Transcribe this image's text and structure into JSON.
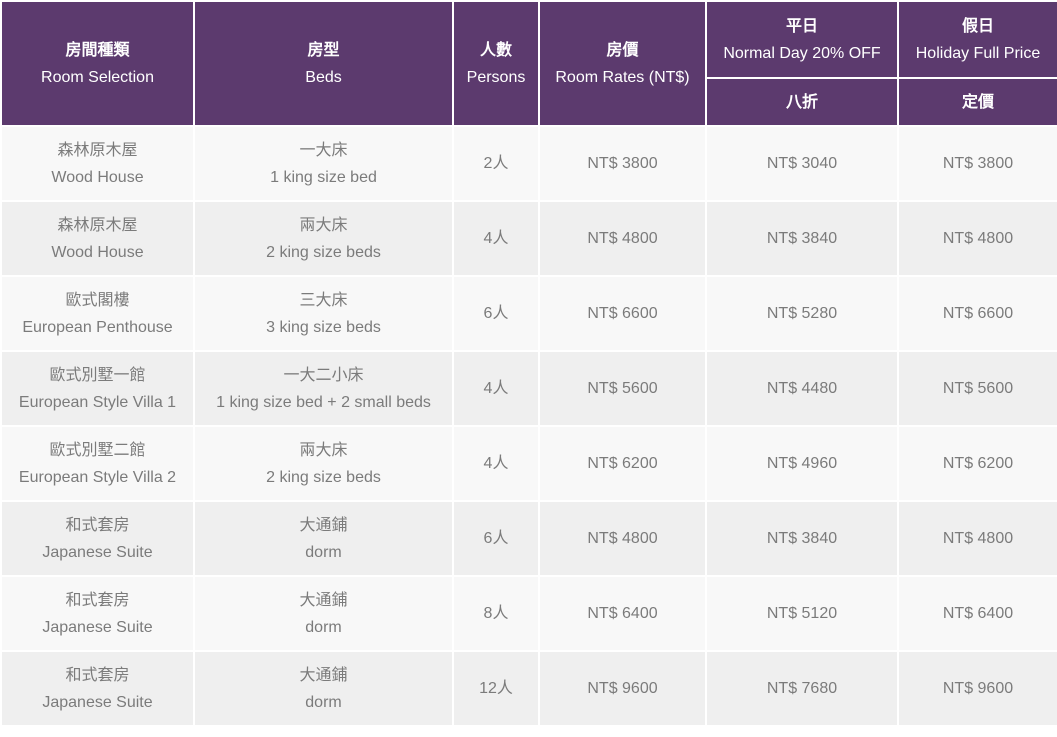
{
  "header": {
    "room": {
      "zh": "房間種類",
      "en": "Room Selection"
    },
    "beds": {
      "zh": "房型",
      "en": "Beds"
    },
    "persons": {
      "zh": "人數",
      "en": "Persons"
    },
    "rates": {
      "zh": "房價",
      "en": "Room Rates (NT$)"
    },
    "normal": {
      "zh": "平日",
      "en": "Normal Day 20% OFF",
      "sub": "八折"
    },
    "holiday": {
      "zh": "假日",
      "en": "Holiday Full Price",
      "sub": "定價"
    }
  },
  "rows": [
    {
      "room_zh": "森林原木屋",
      "room_en": "Wood House",
      "bed_zh": "一大床",
      "bed_en": "1 king size bed",
      "persons": "2人",
      "rate": "NT$ 3800",
      "normal": "NT$ 3040",
      "holiday": "NT$ 3800"
    },
    {
      "room_zh": "森林原木屋",
      "room_en": "Wood House",
      "bed_zh": "兩大床",
      "bed_en": "2 king size beds",
      "persons": "4人",
      "rate": "NT$ 4800",
      "normal": "NT$ 3840",
      "holiday": "NT$ 4800"
    },
    {
      "room_zh": "歐式閣樓",
      "room_en": "European Penthouse",
      "bed_zh": "三大床",
      "bed_en": "3 king size beds",
      "persons": "6人",
      "rate": "NT$ 6600",
      "normal": "NT$ 5280",
      "holiday": "NT$ 6600"
    },
    {
      "room_zh": "歐式別墅一館",
      "room_en": "European Style Villa 1",
      "bed_zh": "一大二小床",
      "bed_en": "1 king size bed + 2 small beds",
      "persons": "4人",
      "rate": "NT$ 5600",
      "normal": "NT$ 4480",
      "holiday": "NT$ 5600"
    },
    {
      "room_zh": "歐式別墅二館",
      "room_en": "European Style Villa 2",
      "bed_zh": "兩大床",
      "bed_en": "2 king size beds",
      "persons": "4人",
      "rate": "NT$ 6200",
      "normal": "NT$ 4960",
      "holiday": "NT$ 6200"
    },
    {
      "room_zh": "和式套房",
      "room_en": "Japanese Suite",
      "bed_zh": "大通鋪",
      "bed_en": "dorm",
      "persons": "6人",
      "rate": "NT$ 4800",
      "normal": "NT$ 3840",
      "holiday": "NT$ 4800"
    },
    {
      "room_zh": "和式套房",
      "room_en": "Japanese Suite",
      "bed_zh": "大通鋪",
      "bed_en": "dorm",
      "persons": "8人",
      "rate": "NT$ 6400",
      "normal": "NT$ 5120",
      "holiday": "NT$ 6400"
    },
    {
      "room_zh": "和式套房",
      "room_en": "Japanese Suite",
      "bed_zh": "大通鋪",
      "bed_en": "dorm",
      "persons": "12人",
      "rate": "NT$ 9600",
      "normal": "NT$ 7680",
      "holiday": "NT$ 9600"
    }
  ],
  "colors": {
    "header_bg": "#5c3a6e",
    "header_text": "#ffffff",
    "row_odd": "#f8f8f8",
    "row_even": "#efefef",
    "body_text": "#7b7b7b"
  }
}
